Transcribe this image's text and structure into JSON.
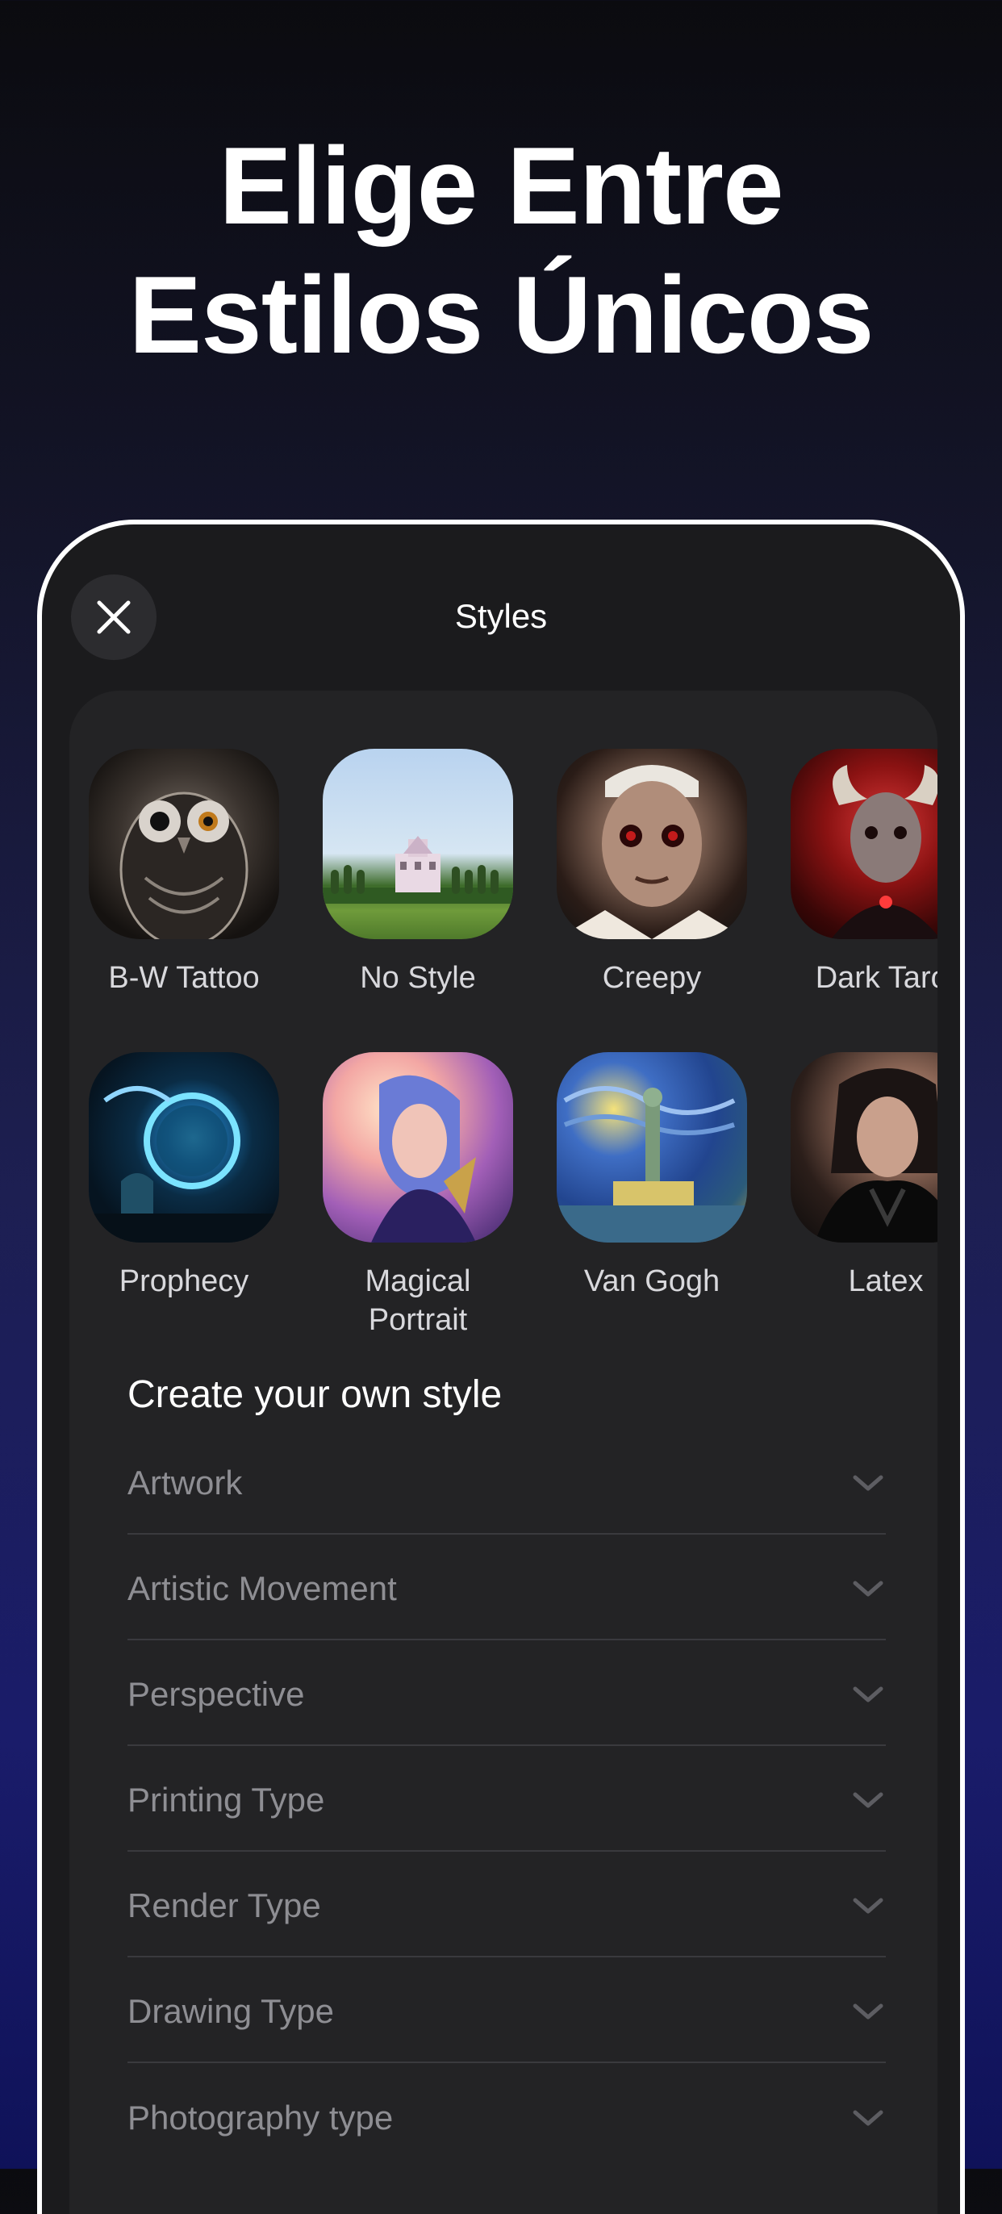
{
  "headline": {
    "line1": "Elige Entre",
    "line2": "Estilos Únicos"
  },
  "screen": {
    "title": "Styles",
    "close_icon": "close-icon"
  },
  "styles": {
    "row1": [
      {
        "label": "B-W Tattoo"
      },
      {
        "label": "No Style"
      },
      {
        "label": "Creepy"
      },
      {
        "label": "Dark Tarot"
      }
    ],
    "row2": [
      {
        "label": "Prophecy"
      },
      {
        "label": "Magical Portrait"
      },
      {
        "label": "Van Gogh"
      },
      {
        "label": "Latex"
      }
    ]
  },
  "custom": {
    "title": "Create your own style",
    "options": [
      {
        "label": "Artwork"
      },
      {
        "label": "Artistic Movement"
      },
      {
        "label": "Perspective"
      },
      {
        "label": "Printing Type"
      },
      {
        "label": "Render Type"
      },
      {
        "label": "Drawing Type"
      },
      {
        "label": "Photography type"
      }
    ]
  }
}
